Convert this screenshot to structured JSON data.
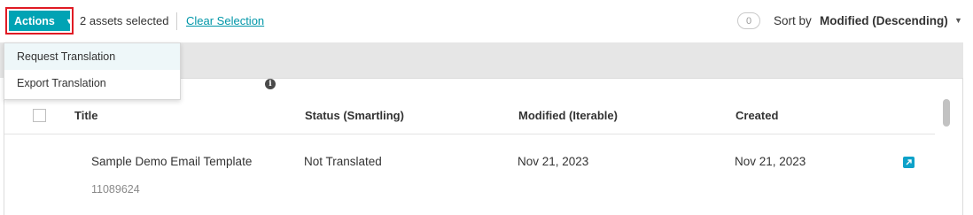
{
  "toolbar": {
    "actions_label": "Actions",
    "selected_count": "2 assets selected",
    "clear_selection": "Clear Selection",
    "filter_count": "0",
    "sort_label": "Sort by",
    "sort_value": "Modified (Descending)"
  },
  "actions_menu": {
    "items": [
      {
        "label": "Request Translation"
      },
      {
        "label": "Export Translation"
      }
    ]
  },
  "table": {
    "headers": {
      "title": "Title",
      "status": "Status (Smartling)",
      "modified": "Modified (Iterable)",
      "created": "Created"
    },
    "rows": [
      {
        "title": "Sample Demo Email Template",
        "id": "11089624",
        "status": "Not Translated",
        "modified": "Nov 21, 2023",
        "created": "Nov 21, 2023",
        "checked": true,
        "icons": [
          "mail-icon",
          "info-icon",
          "open-external-icon"
        ]
      }
    ]
  },
  "colors": {
    "accent": "#00a3b4",
    "highlight_border": "#e01b24",
    "link": "#0096a8"
  }
}
